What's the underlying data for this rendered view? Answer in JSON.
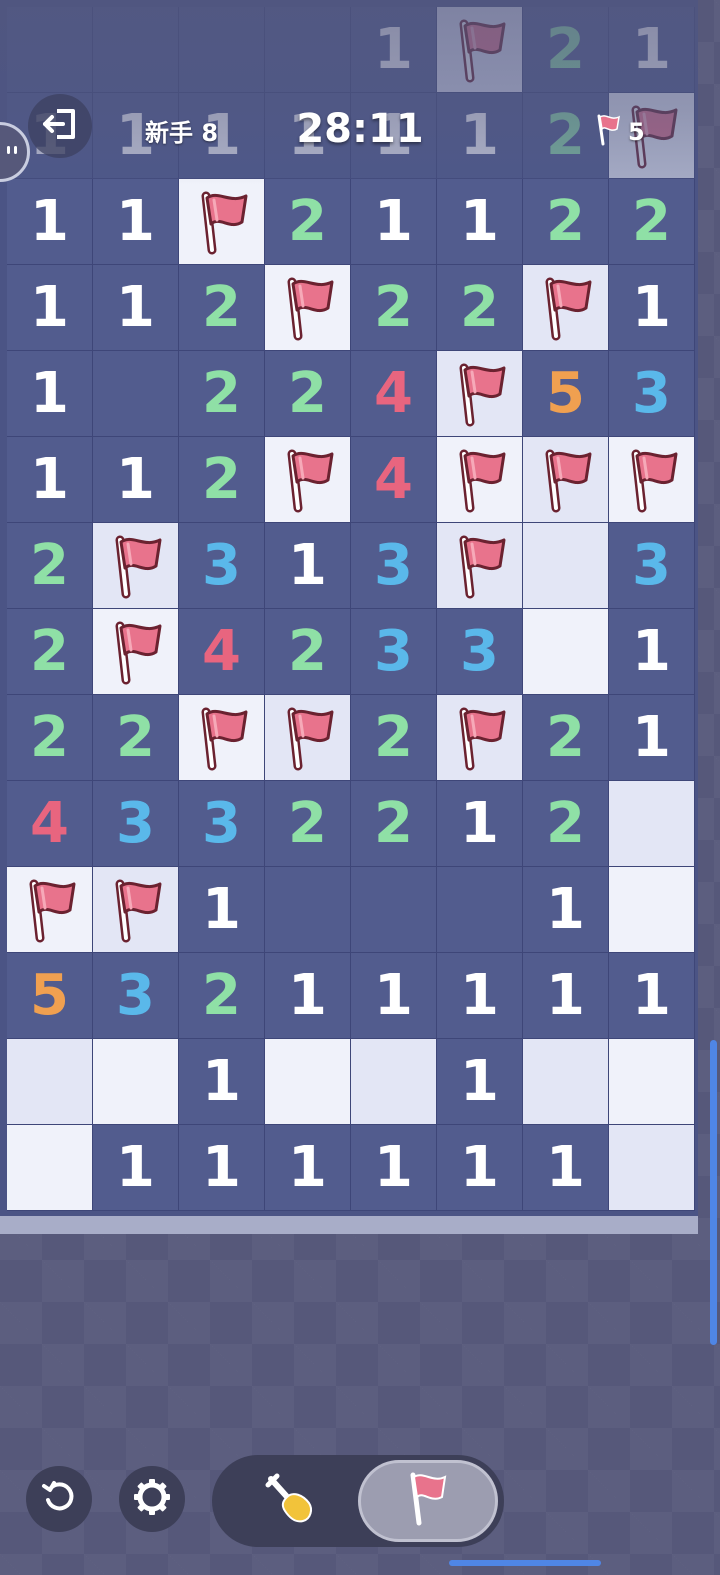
{
  "header": {
    "level_label": "新手 8",
    "timer": "28:11",
    "flags_remaining": "5",
    "exit_icon": "exit-icon",
    "left_handle_icon": "chat-bubble-icon"
  },
  "board": {
    "columns": 8,
    "visible_rows": 14,
    "legend": {
      "F": "flagged tile",
      "L": "unrevealed light tile",
      "M": "unrevealed muted tile",
      "blank": "revealed empty",
      "digit": "revealed number"
    },
    "rows": [
      [
        "",
        "",
        "",
        "",
        "1",
        "F",
        "2",
        "1"
      ],
      [
        "1",
        "1",
        "1",
        "1",
        "1",
        "1",
        "2",
        "F"
      ],
      [
        "1",
        "1",
        "F",
        "2",
        "1",
        "1",
        "2",
        "2"
      ],
      [
        "1",
        "1",
        "2",
        "F",
        "2",
        "2",
        "F",
        "1"
      ],
      [
        "1",
        "",
        "2",
        "2",
        "4",
        "F",
        "5",
        "3"
      ],
      [
        "1",
        "1",
        "2",
        "F",
        "4",
        "F",
        "F",
        "F"
      ],
      [
        "2",
        "F",
        "3",
        "1",
        "3",
        "F",
        "M",
        "3"
      ],
      [
        "2",
        "F",
        "4",
        "2",
        "3",
        "3",
        "L",
        "1"
      ],
      [
        "2",
        "2",
        "F",
        "F",
        "2",
        "F",
        "2",
        "1"
      ],
      [
        "4",
        "3",
        "3",
        "2",
        "2",
        "1",
        "2",
        "M"
      ],
      [
        "F",
        "F",
        "1",
        "",
        "",
        "",
        "1",
        "L"
      ],
      [
        "5",
        "3",
        "2",
        "1",
        "1",
        "1",
        "1",
        "1"
      ],
      [
        "M",
        "L",
        "1",
        "L",
        "M",
        "1",
        "M",
        "L"
      ],
      [
        "L",
        "1",
        "1",
        "1",
        "1",
        "1",
        "1",
        "M"
      ]
    ],
    "number_colors": {
      "1": "#ffffff",
      "2": "#8fe0a6",
      "3": "#5ab8ea",
      "4": "#e8657f",
      "5": "#f0a050"
    },
    "flag_color": "#e8738c"
  },
  "controls": {
    "reset_icon": "restart-icon",
    "settings_icon": "gear-icon",
    "dig_mode_icon": "shovel-icon",
    "flag_mode_icon": "flag-icon",
    "active_mode": "flag"
  },
  "colors": {
    "open_cell": "#525c8e",
    "hidden_light": "#f0f2fa",
    "hidden_muted": "#e3e6f5",
    "scrollbar": "#4f86e6"
  }
}
